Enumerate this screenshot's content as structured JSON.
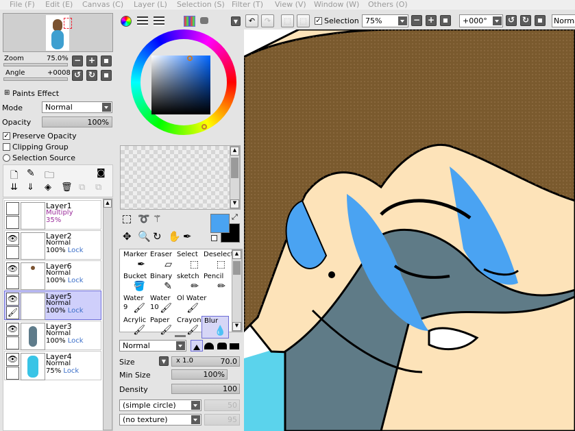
{
  "menu": [
    "File (F)",
    "Edit (E)",
    "Canvas (C)",
    "Layer (L)",
    "Selection (S)",
    "Filter (T)",
    "View (V)",
    "Window (W)",
    "Others (O)"
  ],
  "navigator": {
    "zoom_label": "Zoom",
    "zoom_value": "75.0%",
    "angle_label": "Angle",
    "angle_value": "+0008"
  },
  "layer_props": {
    "paints_effect": "Paints Effect",
    "mode_label": "Mode",
    "mode_value": "Normal",
    "opacity_label": "Opacity",
    "opacity_value": "100%",
    "preserve_opacity": "Preserve Opacity",
    "clipping_group": "Clipping Group",
    "selection_source": "Selection Source"
  },
  "layers": [
    {
      "name": "Layer1",
      "mode": "Multiply",
      "opacity": "35%",
      "lock": "",
      "selected": false,
      "visible": false
    },
    {
      "name": "Layer2",
      "mode": "Normal",
      "opacity": "100%",
      "lock": "Lock",
      "selected": false,
      "visible": true
    },
    {
      "name": "Layer6",
      "mode": "Normal",
      "opacity": "100%",
      "lock": "Lock",
      "selected": false,
      "visible": true
    },
    {
      "name": "Layer5",
      "mode": "Normal",
      "opacity": "100%",
      "lock": "Lock",
      "selected": true,
      "visible": true
    },
    {
      "name": "Layer3",
      "mode": "Normal",
      "opacity": "100%",
      "lock": "Lock",
      "selected": false,
      "visible": true
    },
    {
      "name": "Layer4",
      "mode": "Normal",
      "opacity": "75%",
      "lock": "Lock",
      "selected": false,
      "visible": true
    }
  ],
  "colors": {
    "primary": "#4aa3f2",
    "secondary": "#000000"
  },
  "tools": [
    {
      "name": "Marker",
      "size": "",
      "icon": "marker-icon"
    },
    {
      "name": "Eraser",
      "size": "",
      "icon": "eraser-icon"
    },
    {
      "name": "Select",
      "size": "",
      "icon": "select-icon"
    },
    {
      "name": "Deselect",
      "size": "",
      "icon": "deselect-icon"
    },
    {
      "name": "Bucket",
      "size": "",
      "icon": "bucket-icon"
    },
    {
      "name": "Binary",
      "size": "",
      "icon": "binary-icon"
    },
    {
      "name": "sketch",
      "size": "",
      "icon": "sketch-icon"
    },
    {
      "name": "Pencil",
      "size": "",
      "icon": "pencil-icon"
    },
    {
      "name": "Water",
      "size": "9",
      "icon": "brush-icon"
    },
    {
      "name": "Water",
      "size": "10",
      "icon": "brush-icon"
    },
    {
      "name": "Ol Water",
      "size": "",
      "icon": "brush-icon"
    },
    {
      "name": "",
      "size": "",
      "icon": ""
    },
    {
      "name": "Acrylic",
      "size": "",
      "icon": "brush-icon"
    },
    {
      "name": "Paper",
      "size": "",
      "icon": "brush-icon"
    },
    {
      "name": "Crayon",
      "size": "",
      "icon": "brush-icon"
    },
    {
      "name": "Blur",
      "size": "",
      "icon": "blur-icon",
      "selected": true
    }
  ],
  "brush": {
    "blend_mode": "Normal",
    "size_label": "Size",
    "size_mult": "x 1.0",
    "size_value": "70.0",
    "min_size_label": "Min Size",
    "min_size_value": "100%",
    "density_label": "Density",
    "density_value": "100",
    "shape": "(simple circle)",
    "shape_value": "50",
    "texture": "(no texture)",
    "texture_value": "95"
  },
  "canvas_toolbar": {
    "selection_label": "Selection",
    "zoom": "75%",
    "angle": "+000°",
    "blend": "Norma"
  },
  "accent": "#6b6bd6"
}
